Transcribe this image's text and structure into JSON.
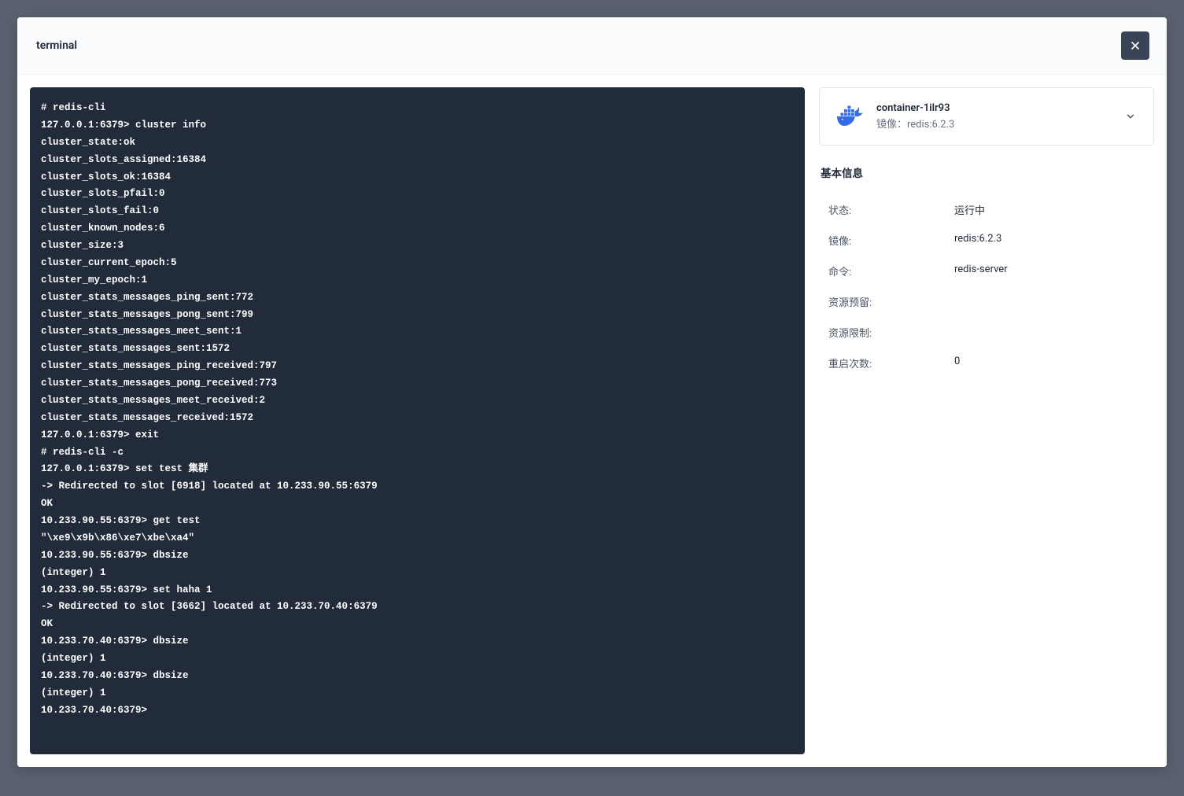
{
  "header": {
    "title": "terminal",
    "close_icon": "close"
  },
  "terminal": {
    "output": "# redis-cli\n127.0.0.1:6379> cluster info\ncluster_state:ok\ncluster_slots_assigned:16384\ncluster_slots_ok:16384\ncluster_slots_pfail:0\ncluster_slots_fail:0\ncluster_known_nodes:6\ncluster_size:3\ncluster_current_epoch:5\ncluster_my_epoch:1\ncluster_stats_messages_ping_sent:772\ncluster_stats_messages_pong_sent:799\ncluster_stats_messages_meet_sent:1\ncluster_stats_messages_sent:1572\ncluster_stats_messages_ping_received:797\ncluster_stats_messages_pong_received:773\ncluster_stats_messages_meet_received:2\ncluster_stats_messages_received:1572\n127.0.0.1:6379> exit\n# redis-cli -c\n127.0.0.1:6379> set test 集群\n-> Redirected to slot [6918] located at 10.233.90.55:6379\nOK\n10.233.90.55:6379> get test\n\"\\xe9\\x9b\\x86\\xe7\\xbe\\xa4\"\n10.233.90.55:6379> dbsize\n(integer) 1\n10.233.90.55:6379> set haha 1\n-> Redirected to slot [3662] located at 10.233.70.40:6379\nOK\n10.233.70.40:6379> dbsize\n(integer) 1\n10.233.70.40:6379> dbsize\n(integer) 1\n10.233.70.40:6379> "
  },
  "container": {
    "name": "container-1ilr93",
    "image_label": "镜像：redis:6.2.3"
  },
  "basic_info": {
    "title": "基本信息",
    "rows": {
      "status": {
        "label": "状态:",
        "value": "运行中"
      },
      "image": {
        "label": "镜像:",
        "value": "redis:6.2.3"
      },
      "command": {
        "label": "命令:",
        "value": "redis-server"
      },
      "resource_request": {
        "label": "资源预留:",
        "value": ""
      },
      "resource_limit": {
        "label": "资源限制:",
        "value": ""
      },
      "restart_count": {
        "label": "重启次数:",
        "value": "0"
      }
    }
  }
}
